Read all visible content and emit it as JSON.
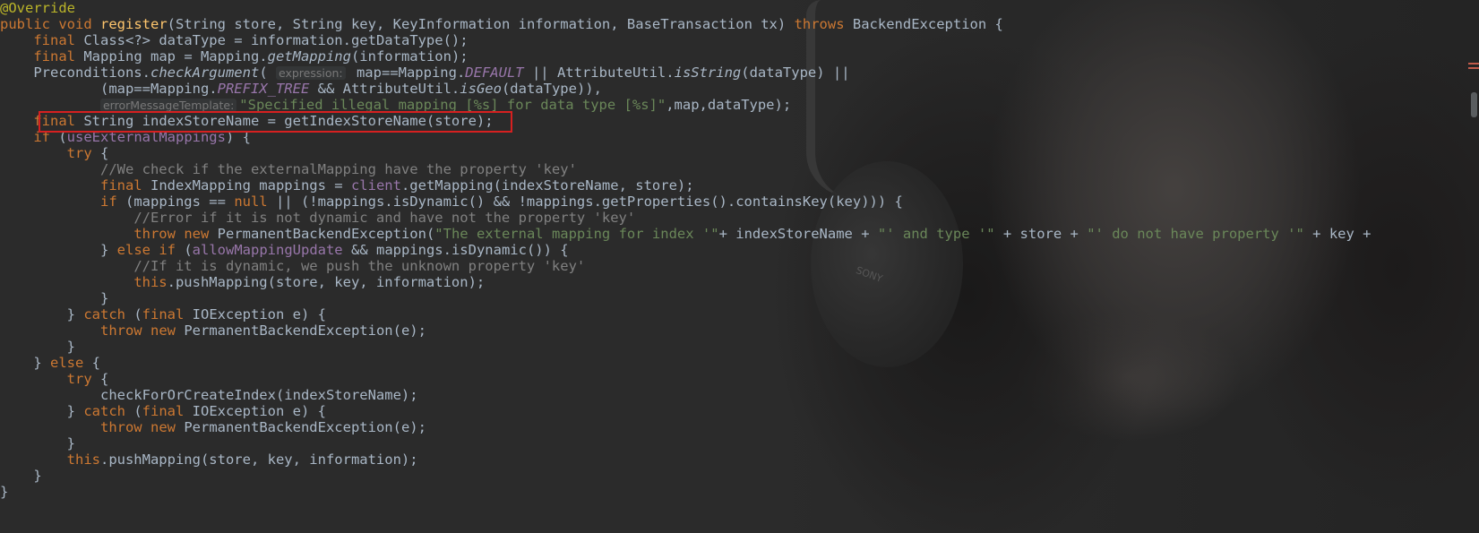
{
  "editor": {
    "theme": "darcula",
    "colors": {
      "keyword": "#cc7832",
      "annotation": "#bbb529",
      "method_declaration": "#ffc66d",
      "string": "#6a8759",
      "comment": "#808080",
      "field": "#9876aa",
      "default_text": "#a9b7c6",
      "highlight_box": "#d62020"
    },
    "scrollbar": {
      "label": "editor-scrollbar"
    }
  },
  "code": {
    "l1": "@Override",
    "l2_public": "public",
    "l2_void": "void",
    "l2_name": "register",
    "l2_params": "(String store, String key, KeyInformation information, BaseTransaction tx) ",
    "l2_throws": "throws",
    "l2_rest": " BackendException {",
    "l3_final": "final",
    "l3_rest": " Class<?> dataType = information.getDataType();",
    "l4_final": "final",
    "l4_a": " Mapping map = Mapping.",
    "l4_method": "getMapping",
    "l4_b": "(information);",
    "l5_a": "Preconditions.",
    "l5_method": "checkArgument",
    "l5_b": "(",
    "l5_hint": "expression:",
    "l5_c": " map==Mapping.",
    "l5_const": "DEFAULT",
    "l5_d": " || AttributeUtil.",
    "l5_method2": "isString",
    "l5_e": "(dataType) ||",
    "l6_a": "(map==Mapping.",
    "l6_const": "PREFIX_TREE",
    "l6_b": " && AttributeUtil.",
    "l6_method": "isGeo",
    "l6_c": "(dataType)),",
    "l7_hint": "errorMessageTemplate:",
    "l7_str": "\"Specified illegal mapping [%s] for data type [%s]\"",
    "l7_rest": ",map,dataType);",
    "l8_final": "final",
    "l8_rest": " String indexStoreName = getIndexStoreName(store);",
    "l9_if": "if",
    "l9_a": " (",
    "l9_field": "useExternalMappings",
    "l9_b": ") {",
    "l10_try": "try",
    "l10_rest": " {",
    "l11": "//We check if the externalMapping have the property 'key'",
    "l12_final": "final",
    "l12_a": " IndexMapping mappings = ",
    "l12_field": "client",
    "l12_b": ".getMapping(indexStoreName, store);",
    "l13_if": "if",
    "l13_a": " (mappings == ",
    "l13_null": "null",
    "l13_b": " || (!mappings.isDynamic() && !mappings.getProperties().containsKey(key))) {",
    "l14": "//Error if it is not dynamic and have not the property 'key'",
    "l15_throw": "throw",
    "l15_new": "new",
    "l15_a": " PermanentBackendException(",
    "l15_s1": "\"The external mapping for index '\"",
    "l15_b": "+ indexStoreName + ",
    "l15_s2": "\"' and type '\"",
    "l15_c": " + store + ",
    "l15_s3": "\"' do not have property '\"",
    "l15_d": " + key +",
    "l16_a": "} ",
    "l16_else": "else",
    "l16_if": "if",
    "l16_b": " (",
    "l16_field": "allowMappingUpdate",
    "l16_c": " && mappings.isDynamic()) {",
    "l17": "//If it is dynamic, we push the unknown property 'key'",
    "l18_this": "this",
    "l18_rest": ".pushMapping(store, key, information);",
    "l19": "}",
    "l20_a": "} ",
    "l20_catch": "catch",
    "l20_b": " (",
    "l20_final": "final",
    "l20_c": " IOException e) {",
    "l21_throw": "throw",
    "l21_new": "new",
    "l21_rest": " PermanentBackendException(e);",
    "l22": "}",
    "l23_a": "} ",
    "l23_else": "else",
    "l23_b": " {",
    "l24_try": "try",
    "l24_rest": " {",
    "l25": "checkForOrCreateIndex(indexStoreName);",
    "l26_a": "} ",
    "l26_catch": "catch",
    "l26_b": " (",
    "l26_final": "final",
    "l26_c": " IOException e) {",
    "l27_throw": "throw",
    "l27_new": "new",
    "l27_rest": " PermanentBackendException(e);",
    "l28": "}",
    "l29_this": "this",
    "l29_rest": ".pushMapping(store, key, information);",
    "l30": "}",
    "l31": "}"
  },
  "background": {
    "brand_text": "SONY"
  }
}
